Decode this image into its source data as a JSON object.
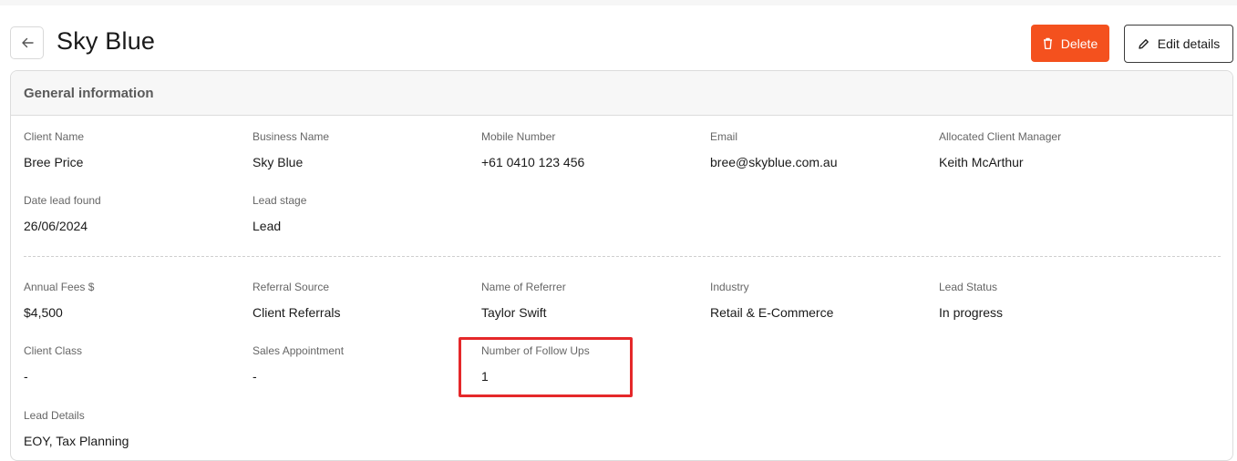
{
  "page": {
    "title": "Sky Blue"
  },
  "actions": {
    "delete_label": "Delete",
    "edit_label": "Edit details"
  },
  "general": {
    "title": "General information",
    "section1": [
      {
        "label": "Client Name",
        "value": "Bree Price"
      },
      {
        "label": "Business Name",
        "value": "Sky Blue"
      },
      {
        "label": "Mobile Number",
        "value": "+61 0410 123 456"
      },
      {
        "label": "Email",
        "value": "bree@skyblue.com.au"
      },
      {
        "label": "Allocated Client Manager",
        "value": "Keith McArthur"
      },
      {
        "label": "Date lead found",
        "value": "26/06/2024"
      },
      {
        "label": "Lead stage",
        "value": "Lead"
      }
    ],
    "section2": [
      {
        "label": "Annual Fees $",
        "value": "$4,500"
      },
      {
        "label": "Referral Source",
        "value": "Client Referrals"
      },
      {
        "label": "Name of Referrer",
        "value": "Taylor Swift"
      },
      {
        "label": "Industry",
        "value": "Retail & E-Commerce"
      },
      {
        "label": "Lead Status",
        "value": "In progress"
      },
      {
        "label": "Client Class",
        "value": "-"
      },
      {
        "label": "Sales Appointment",
        "value": "-"
      },
      {
        "label": "Number of Follow Ups",
        "value": "1"
      },
      {
        "label": "Lead Details",
        "value": "EOY, Tax Planning"
      }
    ]
  },
  "colors": {
    "delete_bg": "#f4511e",
    "highlight": "#e5282a"
  },
  "icons": {
    "back": "arrow-left-icon",
    "delete": "trash-icon",
    "edit": "pencil-icon"
  }
}
